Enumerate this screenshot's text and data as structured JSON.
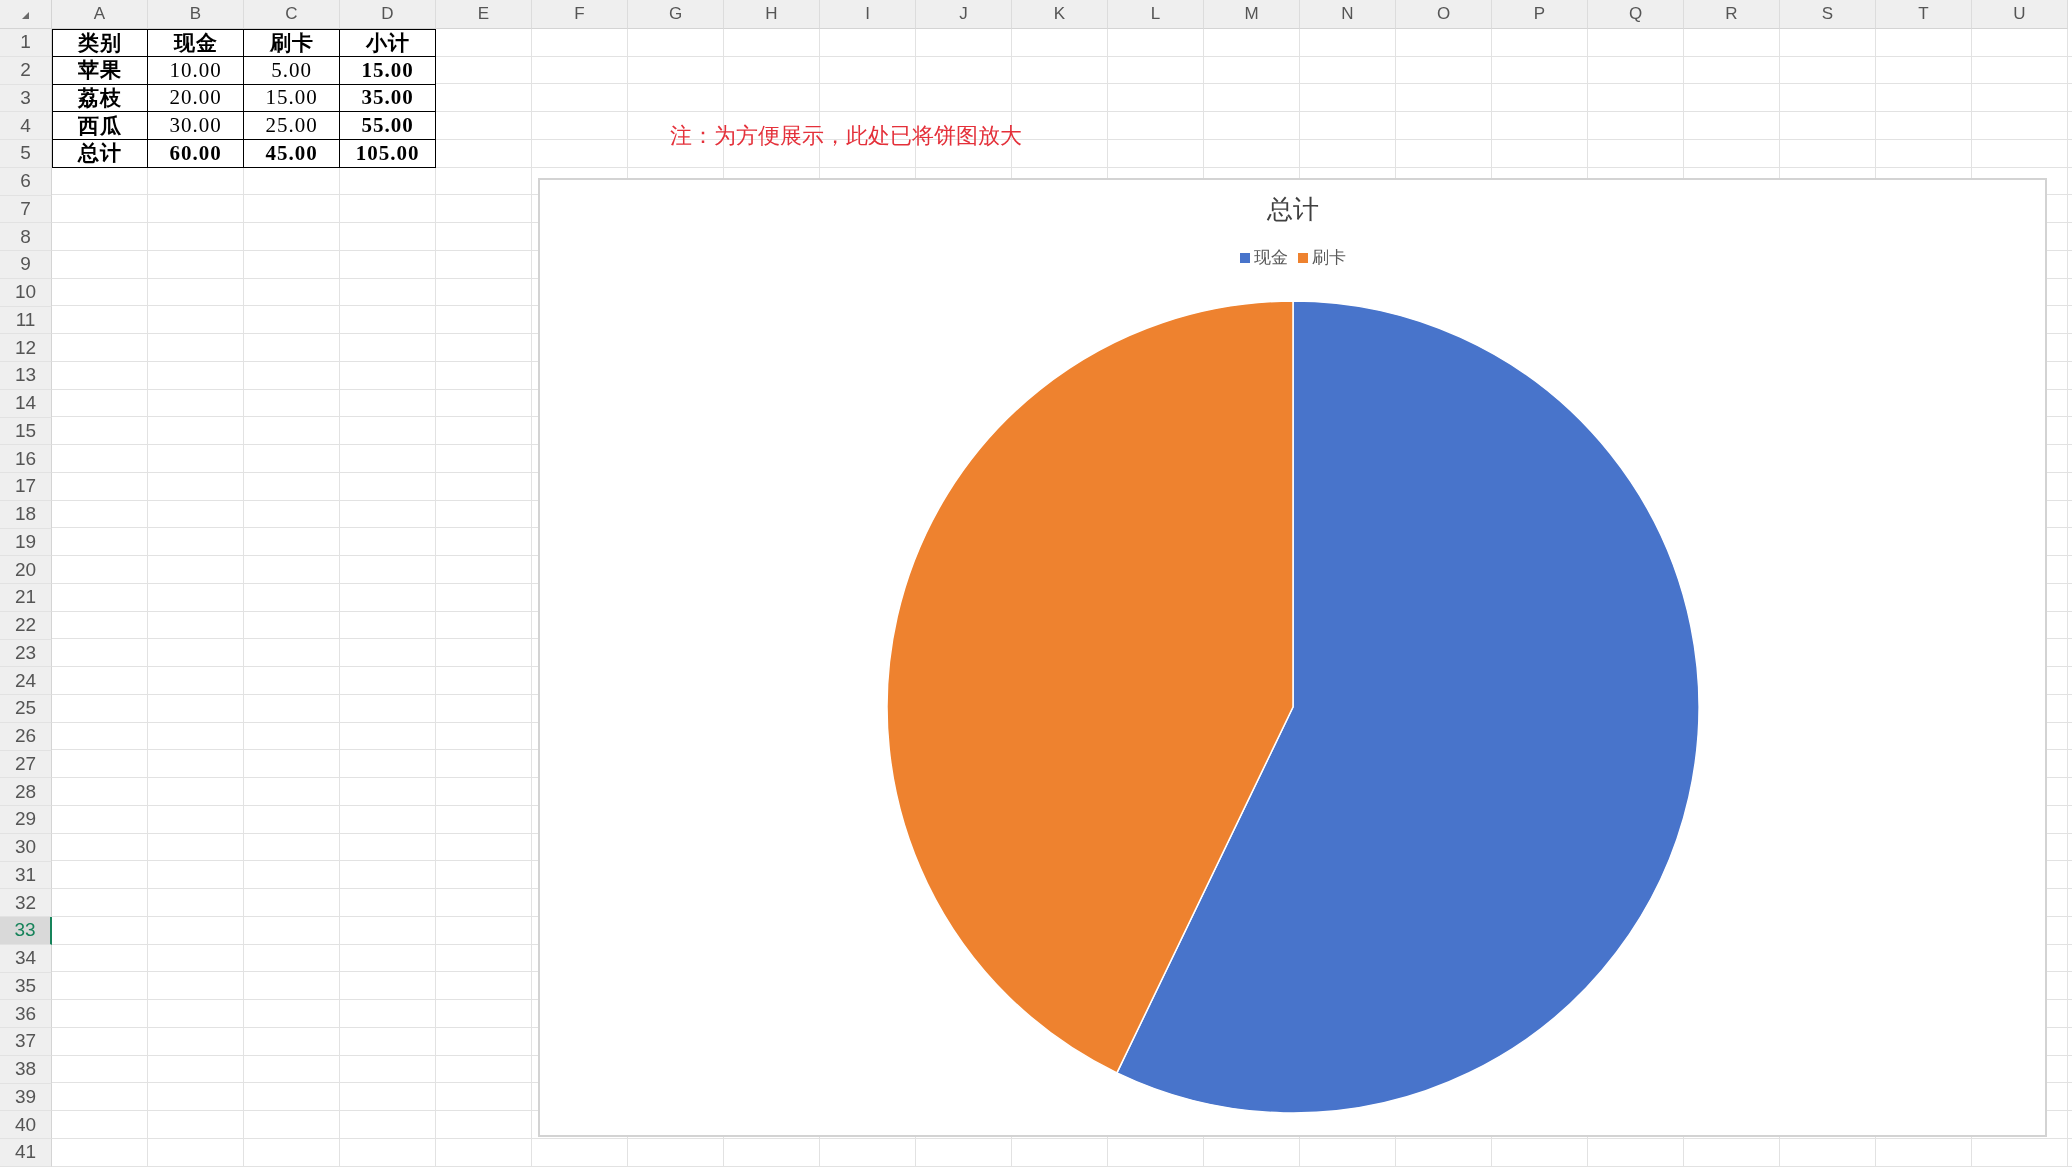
{
  "sheet": {
    "column_headers": [
      "A",
      "B",
      "C",
      "D",
      "E",
      "F",
      "G",
      "H",
      "I",
      "J",
      "K",
      "L",
      "M",
      "N",
      "O",
      "P",
      "Q",
      "R",
      "S",
      "T",
      "U"
    ],
    "row_headers": [
      {
        "label": "1",
        "selected": false
      },
      {
        "label": "2",
        "selected": false
      },
      {
        "label": "3",
        "selected": false
      },
      {
        "label": "4",
        "selected": false
      },
      {
        "label": "5",
        "selected": false
      },
      {
        "label": "6",
        "selected": false
      },
      {
        "label": "7",
        "selected": false
      },
      {
        "label": "8",
        "selected": false
      },
      {
        "label": "9",
        "selected": false
      },
      {
        "label": "10",
        "selected": false
      },
      {
        "label": "11",
        "selected": false
      },
      {
        "label": "12",
        "selected": false
      },
      {
        "label": "13",
        "selected": false
      },
      {
        "label": "14",
        "selected": false
      },
      {
        "label": "15",
        "selected": false
      },
      {
        "label": "16",
        "selected": false
      },
      {
        "label": "17",
        "selected": false
      },
      {
        "label": "18",
        "selected": false
      },
      {
        "label": "19",
        "selected": false
      },
      {
        "label": "20",
        "selected": false
      },
      {
        "label": "21",
        "selected": false
      },
      {
        "label": "22",
        "selected": false
      },
      {
        "label": "23",
        "selected": false
      },
      {
        "label": "24",
        "selected": false
      },
      {
        "label": "25",
        "selected": false
      },
      {
        "label": "26",
        "selected": false
      },
      {
        "label": "27",
        "selected": false
      },
      {
        "label": "28",
        "selected": false
      },
      {
        "label": "29",
        "selected": false
      },
      {
        "label": "30",
        "selected": false
      },
      {
        "label": "31",
        "selected": false
      },
      {
        "label": "32",
        "selected": false
      },
      {
        "label": "33",
        "selected": true
      },
      {
        "label": "34",
        "selected": false
      },
      {
        "label": "35",
        "selected": false
      },
      {
        "label": "36",
        "selected": false
      },
      {
        "label": "37",
        "selected": false
      },
      {
        "label": "38",
        "selected": false
      },
      {
        "label": "39",
        "selected": false
      },
      {
        "label": "40",
        "selected": false
      },
      {
        "label": "41",
        "selected": false
      }
    ],
    "table": {
      "header": [
        "类别",
        "现金",
        "刷卡",
        "小计"
      ],
      "rows": [
        [
          "苹果",
          "10.00",
          "5.00",
          "15.00"
        ],
        [
          "荔枝",
          "20.00",
          "15.00",
          "35.00"
        ],
        [
          "西瓜",
          "30.00",
          "25.00",
          "55.00"
        ]
      ],
      "total": [
        "总计",
        "60.00",
        "45.00",
        "105.00"
      ]
    },
    "note": "注：为方便展示，此处已将饼图放大",
    "chart": {
      "chart_data": {
        "type": "pie",
        "title": "总计",
        "legend": "top",
        "categories": [
          "现金",
          "刷卡"
        ],
        "values": [
          57.14,
          42.86
        ]
      },
      "slices": [
        {
          "color": "#4874cb"
        },
        {
          "color": "#ee822f"
        }
      ]
    }
  }
}
